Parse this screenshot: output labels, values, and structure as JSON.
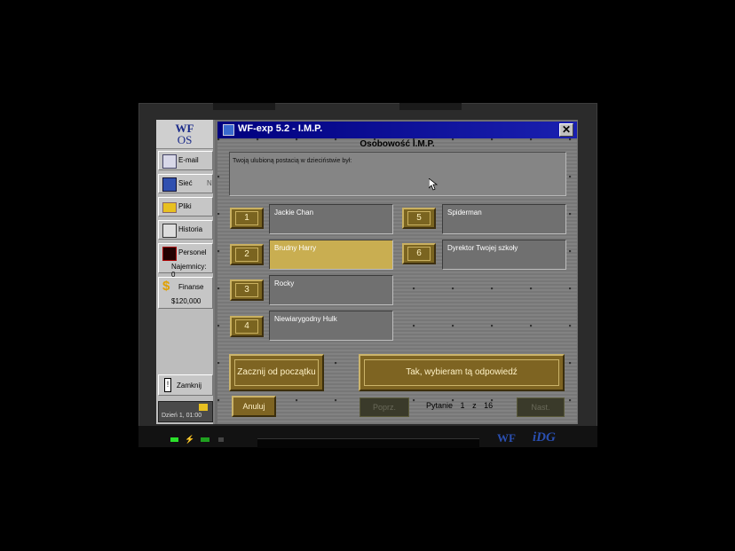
{
  "os_logo": {
    "line1": "WF",
    "line2": "OS"
  },
  "sidebar": {
    "items": [
      {
        "label": "E-mail",
        "icon": "email-icon"
      },
      {
        "label": "Sieć",
        "icon": "network-icon",
        "extra": "N"
      },
      {
        "label": "Pliki",
        "icon": "folder-icon"
      },
      {
        "label": "Historia",
        "icon": "book-icon"
      },
      {
        "label": "Personel",
        "icon": "personnel-icon",
        "sub": "Najemnicy: 0"
      },
      {
        "label": "Finanse",
        "icon": "dollar-icon",
        "sub": "$120,000"
      }
    ],
    "close_label": "Zamknij",
    "date": "Dzień 1, 01:00"
  },
  "window": {
    "title": "WF-exp 5.2  -  I.M.P.",
    "close_glyph": "✕",
    "heading": "Osobowość I.M.P.",
    "question": "Twoją ulubioną postacią w dzieciństwie był:",
    "answers": [
      {
        "num": "1",
        "text": "Jackie Chan"
      },
      {
        "num": "2",
        "text": "Brudny Harry"
      },
      {
        "num": "3",
        "text": "Rocky"
      },
      {
        "num": "4",
        "text": "Niewiarygodny Hulk"
      },
      {
        "num": "5",
        "text": "Spiderman"
      },
      {
        "num": "6",
        "text": "Dyrektor Twojej szkoły"
      }
    ],
    "selected_answer": "2",
    "restart_label": "Zacznij od początku",
    "confirm_label": "Tak, wybieram tą odpowiedź",
    "cancel_label": "Anuluj",
    "prev_label": "Poprz.",
    "next_label": "Nast.",
    "progress": {
      "label": "Pytanie",
      "current": "1",
      "sep": "z",
      "total": "16"
    }
  },
  "footer": {
    "wf": "WF",
    "idg": "iDG"
  },
  "colors": {
    "titlebar": "#00007e",
    "gold": "#7e6422",
    "selected": "#c9ae51"
  }
}
